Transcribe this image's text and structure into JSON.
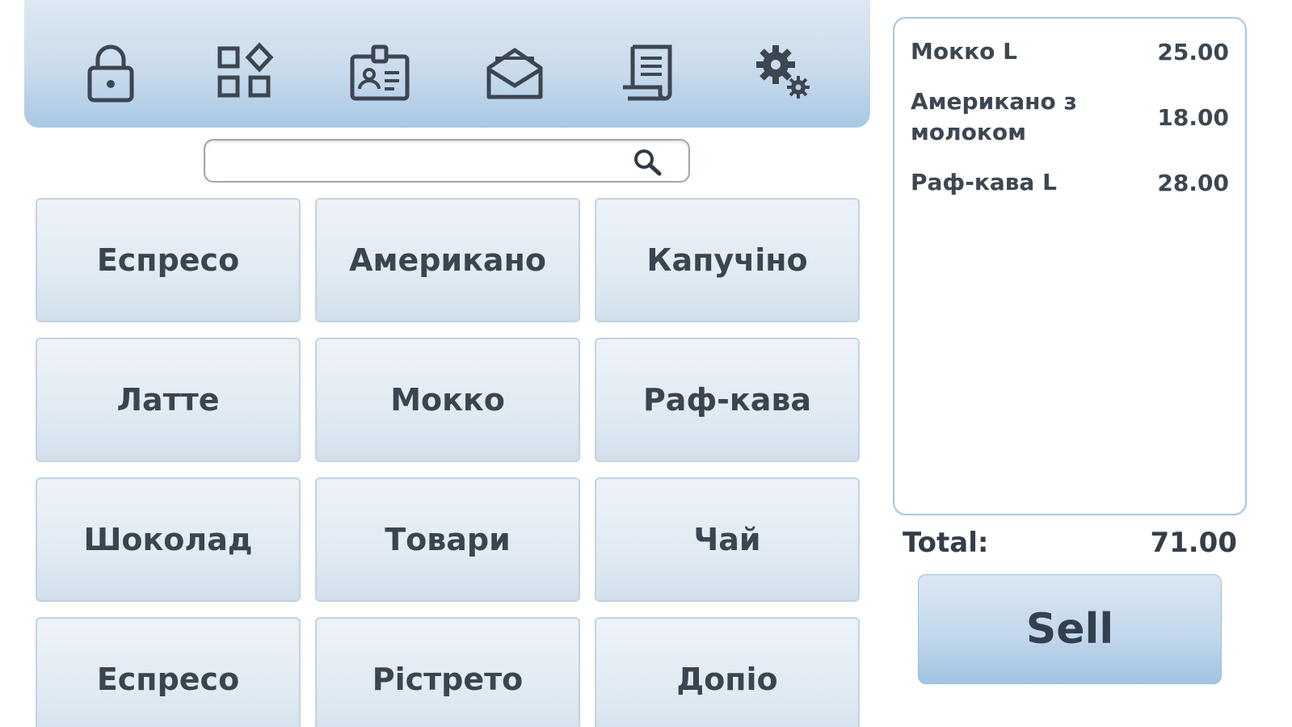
{
  "toolbar": {
    "buttons": [
      {
        "icon": "lock-icon"
      },
      {
        "icon": "apps-grid-icon"
      },
      {
        "icon": "id-badge-icon"
      },
      {
        "icon": "mail-open-icon"
      },
      {
        "icon": "receipt-icon"
      },
      {
        "icon": "gears-icon"
      }
    ]
  },
  "search": {
    "value": "",
    "placeholder": ""
  },
  "products": [
    {
      "label": "Еспресо"
    },
    {
      "label": "Американо"
    },
    {
      "label": "Капучіно"
    },
    {
      "label": "Латте"
    },
    {
      "label": "Мокко"
    },
    {
      "label": "Раф-кава"
    },
    {
      "label": "Шоколад"
    },
    {
      "label": "Товари"
    },
    {
      "label": "Чай"
    },
    {
      "label": "Еспресо"
    },
    {
      "label": "Рістрето"
    },
    {
      "label": "Допіо"
    }
  ],
  "receipt": {
    "items": [
      {
        "name": "Мокко L",
        "price": "25.00"
      },
      {
        "name": "Американо з молоком",
        "price": "18.00"
      },
      {
        "name": "Раф-кава L",
        "price": "28.00"
      }
    ]
  },
  "total": {
    "label": "Total:",
    "value": "71.00"
  },
  "sell_label": "Sell",
  "colors": {
    "toolbar_top": "#dde8f2",
    "toolbar_bottom": "#a9c8e4",
    "button_face": "#e1eaf2",
    "button_border": "#c3d3e2",
    "panel_border": "#a6c6e4",
    "text": "#3a4550"
  }
}
